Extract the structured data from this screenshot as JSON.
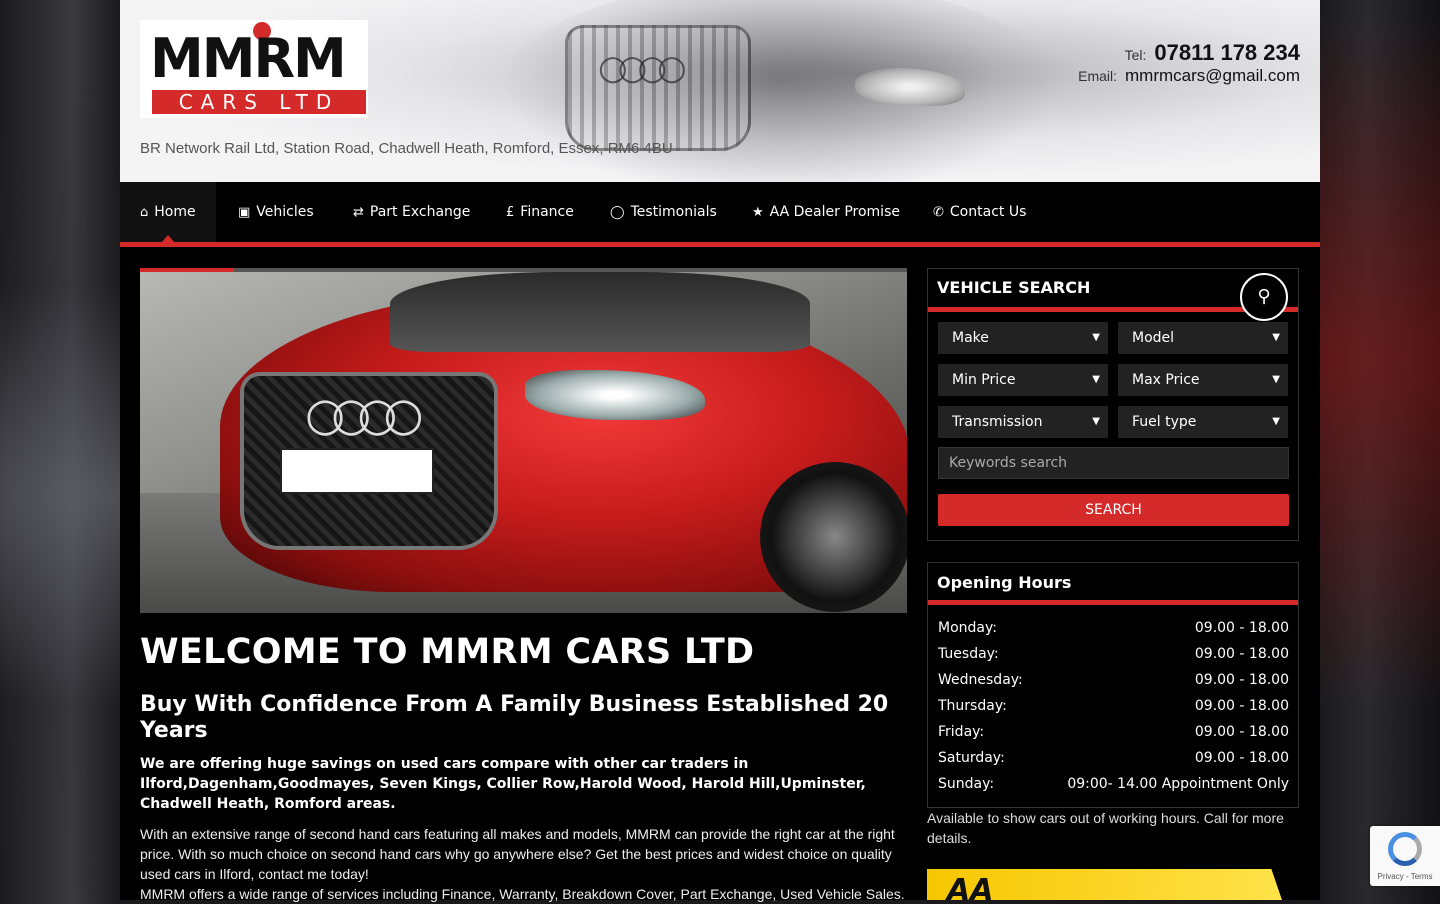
{
  "header": {
    "logo_top": "MMRM",
    "logo_bottom": "CARS LTD",
    "address": "BR Network Rail Ltd, Station Road, Chadwell Heath, Romford, Essex, RM6 4BU",
    "tel_label": "Tel:",
    "tel": "07811 178 234",
    "email_label": "Email:",
    "email": "mmrmcars@gmail.com"
  },
  "nav": {
    "items": [
      {
        "label": "Home",
        "icon": "home-icon"
      },
      {
        "label": "Vehicles",
        "icon": "car-icon"
      },
      {
        "label": "Part Exchange",
        "icon": "exchange-icon"
      },
      {
        "label": "Finance",
        "icon": "pound-icon"
      },
      {
        "label": "Testimonials",
        "icon": "comment-icon"
      },
      {
        "label": "AA Dealer Promise",
        "icon": "star-icon"
      },
      {
        "label": "Contact Us",
        "icon": "phone-icon"
      }
    ],
    "active": "Home"
  },
  "main": {
    "welcome_title": "WELCOME TO MMRM CARS LTD",
    "subtitle": "Buy With Confidence From A Family Business Established 20 Years",
    "strong_text": "We are offering huge savings on used cars compare with other car traders in Ilford,Dagenham,Goodmayes, Seven Kings, Collier Row,Harold Wood, Harold Hill,Upminster, Chadwell Heath, Romford areas.",
    "para1": "With an extensive range of second hand cars featuring all makes and models, MMRM can provide the right car at the right price. With so much choice on second hand cars why go anywhere else? Get the best prices and widest choice on quality used cars in Ilford, contact me today!",
    "para2": "MMRM offers a wide range of services including Finance, Warranty, Breakdown Cover, Part Exchange, Used Vehicle Sales."
  },
  "vehicle_search": {
    "title": "VEHICLE SEARCH",
    "make": "Make",
    "model": "Model",
    "min_price": "Min Price",
    "max_price": "Max Price",
    "transmission": "Transmission",
    "fuel_type": "Fuel type",
    "keywords_placeholder": "Keywords search",
    "search_button": "SEARCH"
  },
  "opening_hours": {
    "title": "Opening Hours",
    "rows": [
      {
        "day": "Monday:",
        "time": "09.00 - 18.00"
      },
      {
        "day": "Tuesday:",
        "time": "09.00 - 18.00"
      },
      {
        "day": "Wednesday:",
        "time": "09.00 - 18.00"
      },
      {
        "day": "Thursday:",
        "time": "09.00 - 18.00"
      },
      {
        "day": "Friday:",
        "time": "09.00 - 18.00"
      },
      {
        "day": "Saturday:",
        "time": "09.00 - 18.00"
      },
      {
        "day": "Sunday:",
        "time": "09:00- 14.00 Appointment Only"
      }
    ],
    "note": "Available to show cars out of working hours. Call for more details."
  },
  "aa_banner_text": "AA",
  "recaptcha": {
    "text": "Privacy - Terms"
  },
  "colors": {
    "accent": "#d42a2a",
    "background": "#000000"
  }
}
